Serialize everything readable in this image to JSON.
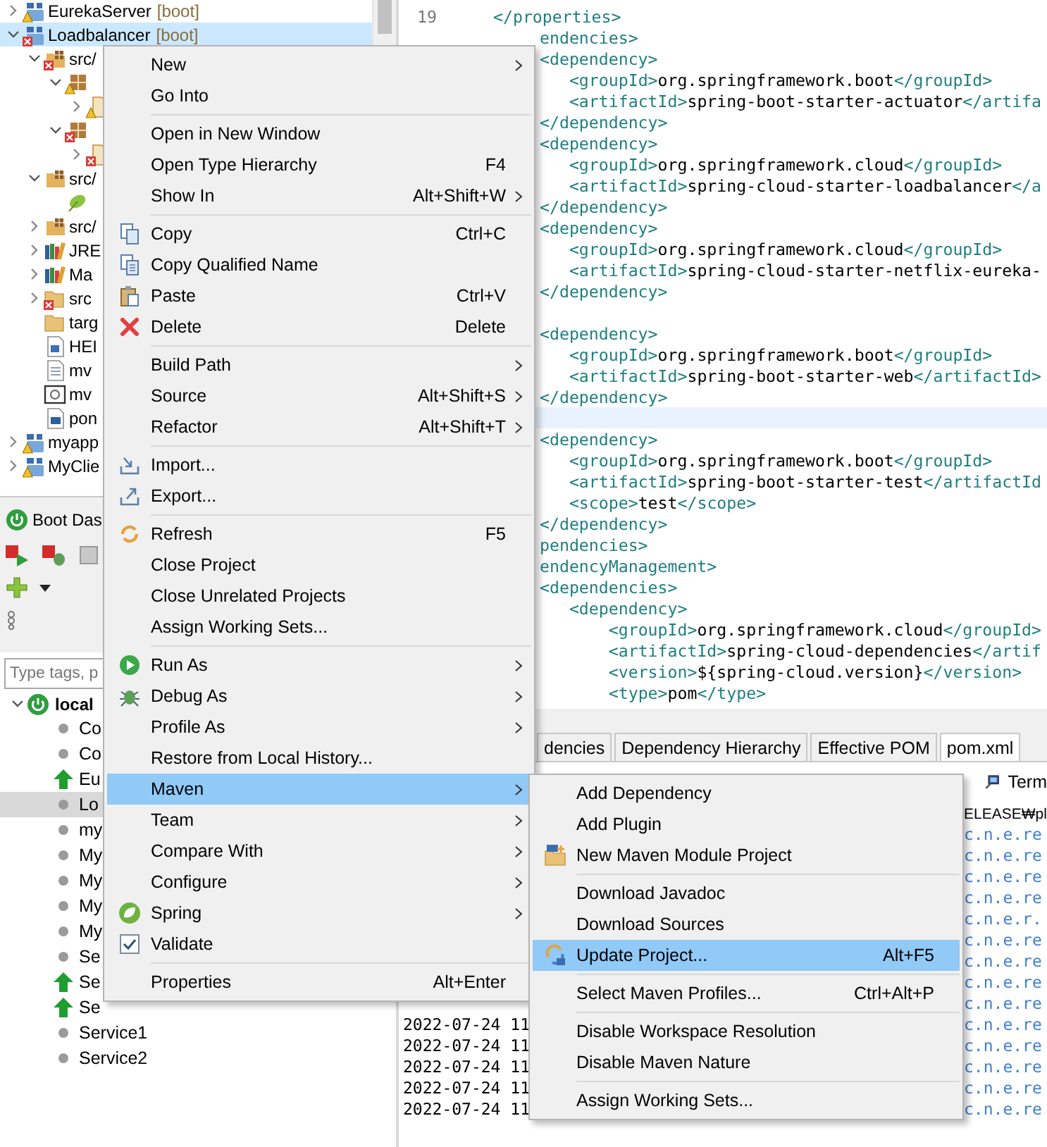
{
  "package_explorer": {
    "tree": [
      {
        "label": "EurekaServer",
        "decoration": "[boot]",
        "kind": "project-warning",
        "expanded": false,
        "selected": false
      },
      {
        "label": "Loadbalancer",
        "decoration": "[boot]",
        "kind": "project-error",
        "expanded": true,
        "selected": true,
        "children": [
          {
            "label": "src/",
            "kind": "srcfolder-error",
            "expanded": true,
            "selected": false,
            "children": [
              {
                "kind": "package-warning",
                "expanded": true,
                "selected": false,
                "children": [
                  {
                    "kind": "javafile-warning",
                    "expanded": false,
                    "selected": false
                  }
                ]
              },
              {
                "kind": "package-error",
                "expanded": true,
                "selected": false,
                "children": [
                  {
                    "kind": "javafile-error",
                    "expanded": false,
                    "selected": false
                  }
                ]
              }
            ]
          },
          {
            "label": "src/",
            "kind": "srcfolder",
            "expanded": true,
            "selected": false,
            "children": [
              {
                "kind": "leaf",
                "selected": false
              }
            ]
          },
          {
            "label": "src/",
            "kind": "srcfolder",
            "expanded": false,
            "selected": false
          },
          {
            "label": "JRE",
            "kind": "library",
            "expanded": false,
            "selected": false
          },
          {
            "label": "Ma",
            "kind": "library",
            "expanded": false,
            "selected": false
          },
          {
            "label": "src",
            "kind": "folder-error",
            "expanded": false,
            "selected": false
          },
          {
            "label": "targ",
            "kind": "folder",
            "selected": false
          },
          {
            "label": "HEI",
            "kind": "wordfile",
            "selected": false
          },
          {
            "label": "mv",
            "kind": "textfile",
            "selected": false
          },
          {
            "label": "mv",
            "kind": "gearfile",
            "selected": false
          },
          {
            "label": "pon",
            "kind": "mavenfile",
            "selected": false
          }
        ]
      },
      {
        "label": "myapp",
        "kind": "project-warning",
        "expanded": false,
        "selected": false
      },
      {
        "label": "MyClie",
        "kind": "project-warning",
        "expanded": false,
        "selected": false
      }
    ]
  },
  "boot_dashboard": {
    "title": "Boot Das",
    "search": {
      "placeholder": "Type tags, p"
    },
    "root": {
      "label": "local",
      "expanded": true,
      "children": [
        {
          "label": "Co",
          "kind": "stopped",
          "selected": false
        },
        {
          "label": "Co",
          "kind": "stopped",
          "selected": false
        },
        {
          "label": "Eu",
          "kind": "running",
          "selected": false
        },
        {
          "label": "Lo",
          "kind": "stopped",
          "selected": true
        },
        {
          "label": "my",
          "kind": "stopped",
          "selected": false
        },
        {
          "label": "My",
          "kind": "stopped",
          "selected": false
        },
        {
          "label": "My",
          "kind": "stopped",
          "selected": false
        },
        {
          "label": "My",
          "kind": "stopped",
          "selected": false
        },
        {
          "label": "My",
          "kind": "stopped",
          "selected": false
        },
        {
          "label": "Se",
          "kind": "stopped",
          "selected": false
        },
        {
          "label": "Se",
          "kind": "running",
          "selected": false
        },
        {
          "label": "Se",
          "kind": "running",
          "selected": false
        },
        {
          "label": "Service1",
          "kind": "stopped",
          "selected": false
        },
        {
          "label": "Service2",
          "kind": "stopped",
          "selected": false
        }
      ]
    }
  },
  "editor": {
    "top_line": {
      "number": "19",
      "text": "</properties>"
    },
    "lines": [
      {
        "text": "endencies>",
        "current": false
      },
      {
        "text": "<dependency>",
        "current": false
      },
      {
        "text": "   <groupId>org.springframework.boot</groupId>",
        "current": false
      },
      {
        "text": "   <artifactId>spring-boot-starter-actuator</artifa",
        "current": false
      },
      {
        "text": "</dependency>",
        "current": false
      },
      {
        "text": "<dependency>",
        "current": false
      },
      {
        "text": "   <groupId>org.springframework.cloud</groupId>",
        "current": false
      },
      {
        "text": "   <artifactId>spring-cloud-starter-loadbalancer</a",
        "current": false
      },
      {
        "text": "</dependency>",
        "current": false
      },
      {
        "text": "<dependency>",
        "current": false
      },
      {
        "text": "   <groupId>org.springframework.cloud</groupId>",
        "current": false
      },
      {
        "text": "   <artifactId>spring-cloud-starter-netflix-eureka-",
        "current": false
      },
      {
        "text": "</dependency>",
        "current": false
      },
      {
        "current": false
      },
      {
        "text": "<dependency>",
        "current": false
      },
      {
        "text": "   <groupId>org.springframework.boot</groupId>",
        "current": false
      },
      {
        "text": "   <artifactId>spring-boot-starter-web</artifactId>",
        "current": false
      },
      {
        "text": "</dependency>",
        "current": false
      },
      {
        "current": true
      },
      {
        "text": "<dependency>",
        "current": false
      },
      {
        "text": "   <groupId>org.springframework.boot</groupId>",
        "current": false
      },
      {
        "text": "   <artifactId>spring-boot-starter-test</artifactId",
        "current": false
      },
      {
        "text": "   <scope>test</scope>",
        "current": false
      },
      {
        "text": "</dependency>",
        "current": false
      },
      {
        "text": "pendencies>",
        "current": false
      },
      {
        "text": "endencyManagement>",
        "current": false
      },
      {
        "text": "<dependencies>",
        "current": false
      },
      {
        "text": "   <dependency>",
        "current": false
      },
      {
        "text": "       <groupId>org.springframework.cloud</groupId>",
        "current": false
      },
      {
        "text": "       <artifactId>spring-cloud-dependencies</artif",
        "current": false
      },
      {
        "text": "       <version>${spring-cloud.version}</version>",
        "current": false
      },
      {
        "text": "       <type>pom</type>",
        "current": false
      }
    ],
    "tabs": [
      {
        "label": "dencies",
        "selected": false
      },
      {
        "label": "Dependency Hierarchy",
        "selected": false
      },
      {
        "label": "Effective POM",
        "selected": false
      },
      {
        "label": "pom.xml",
        "selected": true
      }
    ]
  },
  "console": {
    "terminal_tab": "Term",
    "rows": [
      {
        "kind": "plain",
        "right": "ELEASE₩pl"
      },
      {
        "kind": "log",
        "right": "c.n.e.re"
      },
      {
        "kind": "log",
        "right": "c.n.e.re"
      },
      {
        "kind": "log",
        "right": "c.n.e.re"
      },
      {
        "kind": "log",
        "right": "c.n.e.re"
      },
      {
        "kind": "log",
        "right": "c.n.e.r."
      },
      {
        "kind": "log",
        "right": "c.n.e.re"
      },
      {
        "kind": "log",
        "right": "c.n.e.re"
      },
      {
        "kind": "log",
        "right": "c.n.e.re"
      },
      {
        "kind": "log",
        "right": "c.n.e.re"
      },
      {
        "kind": "log",
        "left": "2022-07-24 11",
        "right": "c.n.e.re"
      },
      {
        "kind": "log",
        "left": "2022-07-24 11",
        "right": "c.n.e.re"
      },
      {
        "kind": "log",
        "left": "2022-07-24 11",
        "right": "c.n.e.re"
      },
      {
        "kind": "log",
        "left": "2022-07-24 11",
        "right": "c.n.e.re"
      },
      {
        "kind": "log",
        "left": "2022-07-24 11",
        "right": "c.n.e.re"
      }
    ]
  },
  "context_menu": {
    "items": [
      {
        "kind": "plain",
        "label": "New",
        "submenu": true,
        "selected": false
      },
      {
        "kind": "plain",
        "label": "Go Into",
        "submenu": false,
        "selected": false
      },
      {
        "kind": "separator"
      },
      {
        "kind": "plain",
        "label": "Open in New Window",
        "submenu": false,
        "selected": false
      },
      {
        "kind": "plain",
        "label": "Open Type Hierarchy",
        "shortcut": "F4",
        "submenu": false,
        "selected": false
      },
      {
        "kind": "plain",
        "label": "Show In",
        "shortcut": "Alt+Shift+W",
        "submenu": true,
        "selected": false
      },
      {
        "kind": "separator"
      },
      {
        "kind": "copy",
        "label": "Copy",
        "shortcut": "Ctrl+C",
        "submenu": false,
        "selected": false
      },
      {
        "kind": "copyname",
        "label": "Copy Qualified Name",
        "submenu": false,
        "selected": false
      },
      {
        "kind": "paste",
        "label": "Paste",
        "shortcut": "Ctrl+V",
        "submenu": false,
        "selected": false
      },
      {
        "kind": "delete",
        "label": "Delete",
        "shortcut": "Delete",
        "submenu": false,
        "selected": false
      },
      {
        "kind": "separator"
      },
      {
        "kind": "plain",
        "label": "Build Path",
        "submenu": true,
        "selected": false
      },
      {
        "kind": "plain",
        "label": "Source",
        "shortcut": "Alt+Shift+S",
        "submenu": true,
        "selected": false
      },
      {
        "kind": "plain",
        "label": "Refactor",
        "shortcut": "Alt+Shift+T",
        "submenu": true,
        "selected": false
      },
      {
        "kind": "separator"
      },
      {
        "kind": "import",
        "label": "Import...",
        "submenu": false,
        "selected": false
      },
      {
        "kind": "export",
        "label": "Export...",
        "submenu": false,
        "selected": false
      },
      {
        "kind": "separator"
      },
      {
        "kind": "refresh",
        "label": "Refresh",
        "shortcut": "F5",
        "submenu": false,
        "selected": false
      },
      {
        "kind": "plain",
        "label": "Close Project",
        "submenu": false,
        "selected": false
      },
      {
        "kind": "plain",
        "label": "Close Unrelated Projects",
        "submenu": false,
        "selected": false
      },
      {
        "kind": "plain",
        "label": "Assign Working Sets...",
        "submenu": false,
        "selected": false
      },
      {
        "kind": "separator"
      },
      {
        "kind": "run",
        "label": "Run As",
        "submenu": true,
        "selected": false
      },
      {
        "kind": "debug",
        "label": "Debug As",
        "submenu": true,
        "selected": false
      },
      {
        "kind": "plain",
        "label": "Profile As",
        "submenu": true,
        "selected": false
      },
      {
        "kind": "plain",
        "label": "Restore from Local History...",
        "submenu": false,
        "selected": false
      },
      {
        "kind": "plain",
        "label": "Maven",
        "submenu": true,
        "selected": true
      },
      {
        "kind": "plain",
        "label": "Team",
        "submenu": true,
        "selected": false
      },
      {
        "kind": "plain",
        "label": "Compare With",
        "submenu": true,
        "selected": false
      },
      {
        "kind": "plain",
        "label": "Configure",
        "submenu": true,
        "selected": false
      },
      {
        "kind": "spring",
        "label": "Spring",
        "submenu": true,
        "selected": false
      },
      {
        "kind": "check",
        "label": "Validate",
        "submenu": false,
        "selected": false
      },
      {
        "kind": "separator"
      },
      {
        "kind": "plain",
        "label": "Properties",
        "shortcut": "Alt+Enter",
        "submenu": false,
        "selected": false
      }
    ]
  },
  "maven_submenu": {
    "items": [
      {
        "kind": "plain",
        "label": "Add Dependency",
        "submenu": false,
        "selected": false
      },
      {
        "kind": "plain",
        "label": "Add Plugin",
        "submenu": false,
        "selected": false
      },
      {
        "kind": "module",
        "label": "New Maven Module Project",
        "submenu": false,
        "selected": false
      },
      {
        "kind": "separator"
      },
      {
        "kind": "plain",
        "label": "Download Javadoc",
        "submenu": false,
        "selected": false
      },
      {
        "kind": "plain",
        "label": "Download Sources",
        "submenu": false,
        "selected": false
      },
      {
        "kind": "update",
        "label": "Update Project...",
        "shortcut": "Alt+F5",
        "submenu": false,
        "selected": true
      },
      {
        "kind": "separator"
      },
      {
        "kind": "plain",
        "label": "Select Maven Profiles...",
        "shortcut": "Ctrl+Alt+P",
        "submenu": false,
        "selected": false
      },
      {
        "kind": "separator"
      },
      {
        "kind": "plain",
        "label": "Disable Workspace Resolution",
        "submenu": false,
        "selected": false
      },
      {
        "kind": "plain",
        "label": "Disable Maven Nature",
        "submenu": false,
        "selected": false
      },
      {
        "kind": "separator"
      },
      {
        "kind": "plain",
        "label": "Assign Working Sets...",
        "submenu": false,
        "selected": false
      }
    ]
  }
}
